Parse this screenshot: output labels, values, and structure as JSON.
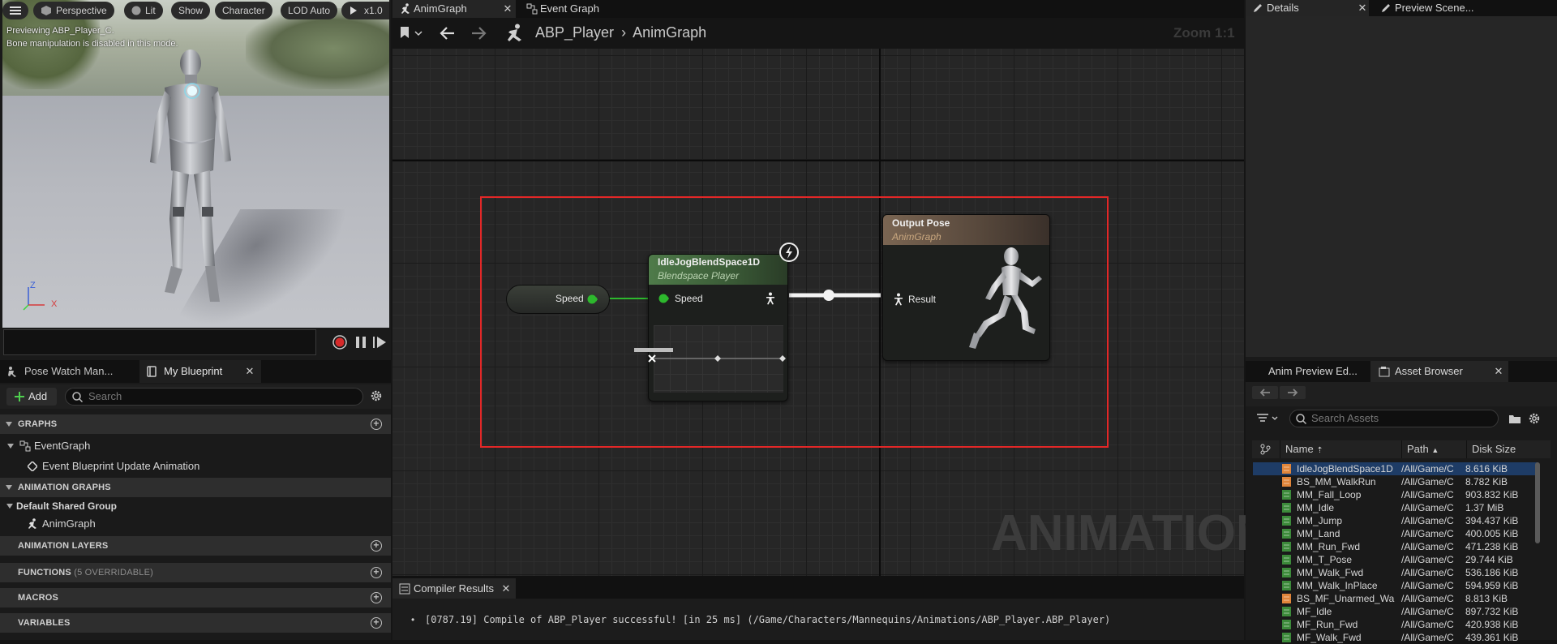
{
  "viewport": {
    "buttons": {
      "perspective": "Perspective",
      "lit": "Lit",
      "show": "Show",
      "character": "Character",
      "lod": "LOD Auto",
      "speed": "x1.0"
    },
    "info_line1": "Previewing ABP_Player_C.",
    "info_line2": "Bone manipulation is disabled in this mode.",
    "axis_z": "Z",
    "axis_x": "X"
  },
  "left_tabs": {
    "pose_watch": "Pose Watch Man...",
    "my_blueprint": "My Blueprint"
  },
  "my_blueprint": {
    "add_label": "Add",
    "search_placeholder": "Search",
    "sections": {
      "graphs": "GRAPHS",
      "animation_graphs": "ANIMATION GRAPHS",
      "animation_layers": "ANIMATION LAYERS",
      "functions": "FUNCTIONS",
      "functions_sub": "(5 OVERRIDABLE)",
      "macros": "MACROS",
      "variables": "VARIABLES"
    },
    "event_graph": "EventGraph",
    "event_update": "Event Blueprint Update Animation",
    "default_group": "Default Shared Group",
    "anim_graph": "AnimGraph"
  },
  "graph": {
    "tabs": {
      "anim_graph": "AnimGraph",
      "event_graph": "Event Graph"
    },
    "breadcrumb": {
      "blueprint": "ABP_Player",
      "graph": "AnimGraph"
    },
    "zoom": "Zoom 1:1",
    "watermark": "ANIMATION",
    "speed_var": "Speed",
    "blendspace": {
      "title": "IdleJogBlendSpace1D",
      "subtitle": "Blendspace Player",
      "pin_speed": "Speed"
    },
    "output": {
      "title": "Output Pose",
      "subtitle": "AnimGraph",
      "pin_result": "Result"
    }
  },
  "compiler": {
    "tab": "Compiler Results",
    "message": "[0787.19] Compile of ABP_Player successful! [in 25 ms] (/Game/Characters/Mannequins/Animations/ABP_Player.ABP_Player)"
  },
  "right_tabs": {
    "details": "Details",
    "preview_scene": "Preview Scene..."
  },
  "asset_tabs": {
    "anim_preview": "Anim Preview Ed...",
    "asset_browser": "Asset Browser"
  },
  "asset_browser": {
    "search_placeholder": "Search Assets",
    "columns": {
      "name": "Name",
      "path": "Path",
      "size": "Disk Size"
    },
    "rows": [
      {
        "name": "IdleJogBlendSpace1D",
        "path": "/All/Game/C",
        "size": "8.616 KiB",
        "type": "blendspace"
      },
      {
        "name": "BS_MM_WalkRun",
        "path": "/All/Game/C",
        "size": "8.782 KiB",
        "type": "blendspace"
      },
      {
        "name": "MM_Fall_Loop",
        "path": "/All/Game/C",
        "size": "903.832 KiB",
        "type": "sequence"
      },
      {
        "name": "MM_Idle",
        "path": "/All/Game/C",
        "size": "1.37 MiB",
        "type": "sequence"
      },
      {
        "name": "MM_Jump",
        "path": "/All/Game/C",
        "size": "394.437 KiB",
        "type": "sequence"
      },
      {
        "name": "MM_Land",
        "path": "/All/Game/C",
        "size": "400.005 KiB",
        "type": "sequence"
      },
      {
        "name": "MM_Run_Fwd",
        "path": "/All/Game/C",
        "size": "471.238 KiB",
        "type": "sequence"
      },
      {
        "name": "MM_T_Pose",
        "path": "/All/Game/C",
        "size": "29.744 KiB",
        "type": "sequence"
      },
      {
        "name": "MM_Walk_Fwd",
        "path": "/All/Game/C",
        "size": "536.186 KiB",
        "type": "sequence"
      },
      {
        "name": "MM_Walk_InPlace",
        "path": "/All/Game/C",
        "size": "594.959 KiB",
        "type": "sequence"
      },
      {
        "name": "BS_MF_Unarmed_Wa",
        "path": "/All/Game/C",
        "size": "8.813 KiB",
        "type": "blendspace"
      },
      {
        "name": "MF_Idle",
        "path": "/All/Game/C",
        "size": "897.732 KiB",
        "type": "sequence"
      },
      {
        "name": "MF_Run_Fwd",
        "path": "/All/Game/C",
        "size": "420.938 KiB",
        "type": "sequence"
      },
      {
        "name": "MF_Walk_Fwd",
        "path": "/All/Game/C",
        "size": "439.361 KiB",
        "type": "sequence"
      }
    ]
  },
  "colors": {
    "accent": "#e32727",
    "pin_green": "#2db82d",
    "blendspace_icon": "#e0853a",
    "sequence_icon": "#3c8a3a",
    "selected_row": "#1e3c66"
  }
}
